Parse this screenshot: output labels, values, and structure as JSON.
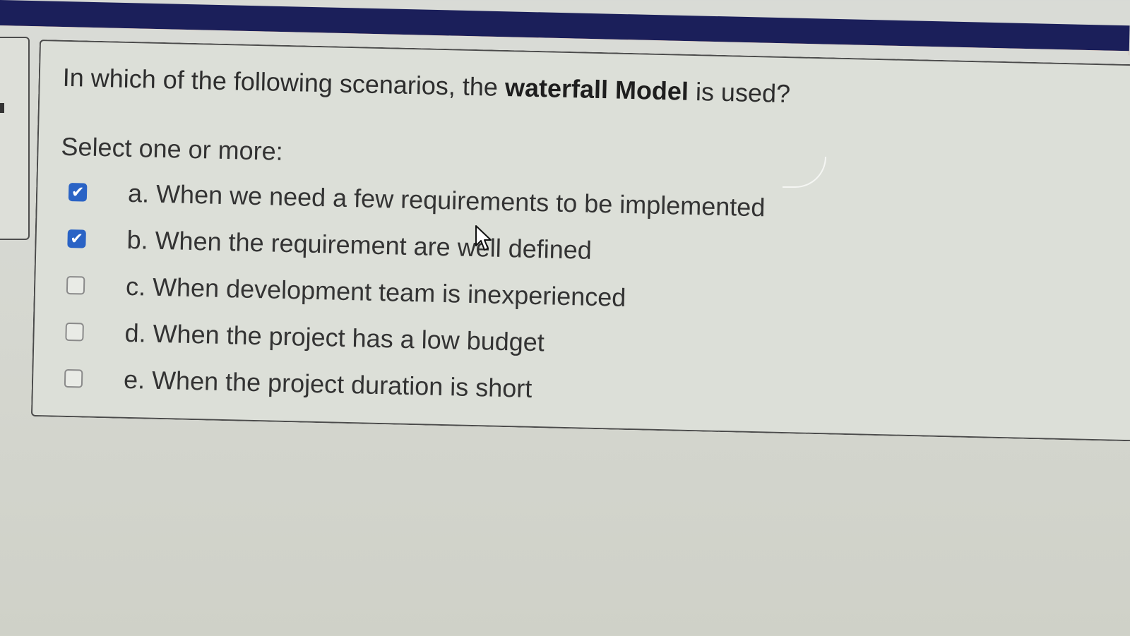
{
  "question": {
    "prefix": "In which of the following scenarios, the ",
    "emphasis": "waterfall Model",
    "suffix": " is used?",
    "instruction": "Select one or more:"
  },
  "options": [
    {
      "label": "a. When we need a few requirements to be implemented",
      "checked": true
    },
    {
      "label": "b. When the requirement are well defined",
      "checked": true
    },
    {
      "label": "c. When development team is inexperienced",
      "checked": false
    },
    {
      "label": "d. When the project has a low budget",
      "checked": false
    },
    {
      "label": "e. When the project duration is short",
      "checked": false
    }
  ],
  "colors": {
    "header": "#1b1f5a",
    "header_stripe": "#e0683d",
    "checked": "#2a63c5"
  }
}
